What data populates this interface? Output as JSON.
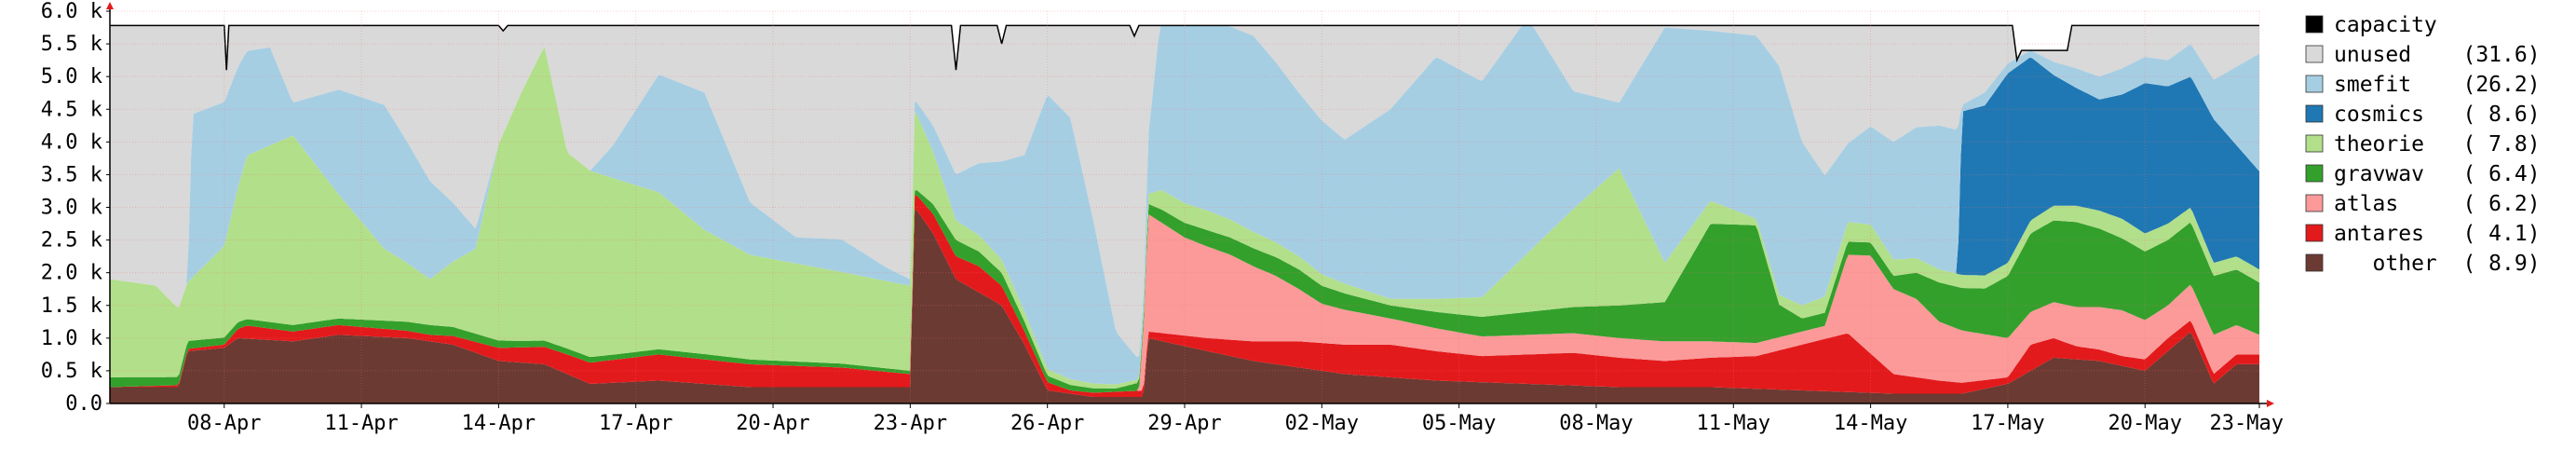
{
  "chart_data": {
    "type": "area",
    "stacked": true,
    "title": "",
    "ylabel": "",
    "ylabel_faint": "",
    "ylim": [
      0,
      6000
    ],
    "y_ticks": [
      {
        "value": 0,
        "label": "0.0"
      },
      {
        "value": 500,
        "label": "0.5 k"
      },
      {
        "value": 1000,
        "label": "1.0 k"
      },
      {
        "value": 1500,
        "label": "1.5 k"
      },
      {
        "value": 2000,
        "label": "2.0 k"
      },
      {
        "value": 2500,
        "label": "2.5 k"
      },
      {
        "value": 3000,
        "label": "3.0 k"
      },
      {
        "value": 3500,
        "label": "3.5 k"
      },
      {
        "value": 4000,
        "label": "4.0 k"
      },
      {
        "value": 4500,
        "label": "4.5 k"
      },
      {
        "value": 5000,
        "label": "5.0 k"
      },
      {
        "value": 5500,
        "label": "5.5 k"
      },
      {
        "value": 6000,
        "label": "6.0 k"
      }
    ],
    "x_start_day": 0,
    "x_end_day": 47,
    "x_ticks": [
      {
        "day": 2.5,
        "label": "08-Apr"
      },
      {
        "day": 5.5,
        "label": "11-Apr"
      },
      {
        "day": 8.5,
        "label": "14-Apr"
      },
      {
        "day": 11.5,
        "label": "17-Apr"
      },
      {
        "day": 14.5,
        "label": "20-Apr"
      },
      {
        "day": 17.5,
        "label": "23-Apr"
      },
      {
        "day": 20.5,
        "label": "26-Apr"
      },
      {
        "day": 23.5,
        "label": "29-Apr"
      },
      {
        "day": 26.5,
        "label": "02-May"
      },
      {
        "day": 29.5,
        "label": "05-May"
      },
      {
        "day": 32.5,
        "label": "08-May"
      },
      {
        "day": 35.5,
        "label": "11-May"
      },
      {
        "day": 38.5,
        "label": "14-May"
      },
      {
        "day": 41.5,
        "label": "17-May"
      },
      {
        "day": 44.5,
        "label": "20-May"
      },
      {
        "day": 47,
        "label": "23-May"
      }
    ],
    "legend": [
      {
        "key": "capacity",
        "label": "capacity",
        "value": "",
        "color": "#000000"
      },
      {
        "key": "unused",
        "label": "unused",
        "value": "(31.6)",
        "color": "#d9d9d9"
      },
      {
        "key": "smefit",
        "label": "smefit",
        "value": "(26.2)",
        "color": "#a6cee3"
      },
      {
        "key": "cosmics",
        "label": "cosmics",
        "value": "( 8.6)",
        "color": "#1f78b4"
      },
      {
        "key": "theorie",
        "label": "theorie",
        "value": "( 7.8)",
        "color": "#b2df8a"
      },
      {
        "key": "gravwav",
        "label": "gravwav",
        "value": "( 6.4)",
        "color": "#33a02c"
      },
      {
        "key": "atlas",
        "label": "atlas",
        "value": "( 6.2)",
        "color": "#fb9a99"
      },
      {
        "key": "antares",
        "label": "antares",
        "value": "( 4.1)",
        "color": "#e31a1c"
      },
      {
        "key": "other",
        "label": "other",
        "value": "( 8.9)",
        "color": "#6b3a32"
      }
    ],
    "capacity": {
      "color": "#000000",
      "points": [
        [
          0,
          5780
        ],
        [
          2.5,
          5780
        ],
        [
          2.55,
          5100
        ],
        [
          2.6,
          5780
        ],
        [
          8.5,
          5780
        ],
        [
          8.6,
          5700
        ],
        [
          8.7,
          5780
        ],
        [
          18.4,
          5780
        ],
        [
          18.5,
          5100
        ],
        [
          18.6,
          5780
        ],
        [
          19.4,
          5780
        ],
        [
          19.5,
          5500
        ],
        [
          19.6,
          5780
        ],
        [
          22.3,
          5780
        ],
        [
          22.4,
          5620
        ],
        [
          22.5,
          5780
        ],
        [
          41.6,
          5780
        ],
        [
          41.7,
          5250
        ],
        [
          41.8,
          5400
        ],
        [
          42.8,
          5400
        ],
        [
          42.9,
          5780
        ],
        [
          47,
          5780
        ]
      ]
    },
    "series": [
      {
        "key": "other",
        "name": "other",
        "color": "#6b3a32",
        "points": [
          [
            0,
            250
          ],
          [
            1.5,
            250
          ],
          [
            1.7,
            800
          ],
          [
            2.5,
            850
          ],
          [
            2.8,
            1000
          ],
          [
            4,
            950
          ],
          [
            5,
            1050
          ],
          [
            6.5,
            1000
          ],
          [
            7.5,
            900
          ],
          [
            8.5,
            650
          ],
          [
            9.5,
            600
          ],
          [
            10.5,
            300
          ],
          [
            12,
            350
          ],
          [
            14,
            250
          ],
          [
            16,
            250
          ],
          [
            17.5,
            250
          ],
          [
            17.6,
            3000
          ],
          [
            18,
            2600
          ],
          [
            18.5,
            1900
          ],
          [
            19.5,
            1500
          ],
          [
            20,
            900
          ],
          [
            20.5,
            200
          ],
          [
            21.5,
            100
          ],
          [
            22.6,
            100
          ],
          [
            22.7,
            1000
          ],
          [
            24,
            800
          ],
          [
            25,
            650
          ],
          [
            27,
            450
          ],
          [
            29,
            350
          ],
          [
            31,
            300
          ],
          [
            33,
            250
          ],
          [
            35,
            250
          ],
          [
            37,
            200
          ],
          [
            39,
            150
          ],
          [
            40.5,
            150
          ],
          [
            41.5,
            300
          ],
          [
            42.5,
            700
          ],
          [
            43.5,
            650
          ],
          [
            44.5,
            500
          ],
          [
            45,
            800
          ],
          [
            45.5,
            1100
          ],
          [
            46,
            300
          ],
          [
            46.5,
            600
          ],
          [
            47,
            600
          ]
        ]
      },
      {
        "key": "antares",
        "name": "antares",
        "color": "#e31a1c",
        "points": [
          [
            0,
            0
          ],
          [
            2.5,
            50
          ],
          [
            3,
            200
          ],
          [
            4,
            150
          ],
          [
            5,
            150
          ],
          [
            7,
            100
          ],
          [
            8.5,
            200
          ],
          [
            10,
            300
          ],
          [
            12,
            400
          ],
          [
            14,
            350
          ],
          [
            16,
            300
          ],
          [
            17.5,
            200
          ],
          [
            18,
            300
          ],
          [
            19,
            400
          ],
          [
            20,
            200
          ],
          [
            21,
            50
          ],
          [
            22.7,
            100
          ],
          [
            24,
            200
          ],
          [
            26,
            400
          ],
          [
            28,
            500
          ],
          [
            30,
            400
          ],
          [
            32,
            500
          ],
          [
            34,
            400
          ],
          [
            36,
            500
          ],
          [
            38,
            900
          ],
          [
            39,
            300
          ],
          [
            40,
            200
          ],
          [
            41.5,
            100
          ],
          [
            42,
            400
          ],
          [
            43,
            200
          ],
          [
            44,
            150
          ],
          [
            45,
            200
          ],
          [
            46,
            150
          ],
          [
            47,
            150
          ]
        ]
      },
      {
        "key": "atlas",
        "name": "atlas",
        "color": "#fb9a99",
        "points": [
          [
            0,
            0
          ],
          [
            17.5,
            0
          ],
          [
            22.5,
            0
          ],
          [
            22.7,
            1800
          ],
          [
            23.5,
            1500
          ],
          [
            24.5,
            1300
          ],
          [
            25.5,
            1000
          ],
          [
            26.5,
            600
          ],
          [
            28,
            400
          ],
          [
            30,
            300
          ],
          [
            32,
            300
          ],
          [
            34,
            300
          ],
          [
            36,
            200
          ],
          [
            37.5,
            200
          ],
          [
            38,
            1200
          ],
          [
            38.5,
            1500
          ],
          [
            39,
            1300
          ],
          [
            39.5,
            1200
          ],
          [
            40,
            900
          ],
          [
            41,
            700
          ],
          [
            42,
            500
          ],
          [
            43,
            600
          ],
          [
            44,
            700
          ],
          [
            45,
            500
          ],
          [
            46,
            600
          ],
          [
            47,
            300
          ]
        ]
      },
      {
        "key": "gravwav",
        "name": "gravwav",
        "color": "#33a02c",
        "points": [
          [
            0,
            150
          ],
          [
            3,
            100
          ],
          [
            5,
            100
          ],
          [
            7,
            150
          ],
          [
            9,
            100
          ],
          [
            11,
            80
          ],
          [
            13,
            80
          ],
          [
            17.5,
            50
          ],
          [
            18.5,
            250
          ],
          [
            19.5,
            200
          ],
          [
            20.5,
            100
          ],
          [
            22,
            50
          ],
          [
            23,
            200
          ],
          [
            24,
            250
          ],
          [
            26,
            300
          ],
          [
            28,
            200
          ],
          [
            30,
            300
          ],
          [
            32,
            400
          ],
          [
            34,
            600
          ],
          [
            35,
            1800
          ],
          [
            36,
            1800
          ],
          [
            36.5,
            500
          ],
          [
            37,
            200
          ],
          [
            39,
            200
          ],
          [
            40,
            600
          ],
          [
            41,
            700
          ],
          [
            42,
            1200
          ],
          [
            43,
            1300
          ],
          [
            44,
            1100
          ],
          [
            45,
            1000
          ],
          [
            46,
            900
          ],
          [
            47,
            800
          ]
        ]
      },
      {
        "key": "theorie",
        "name": "theorie",
        "color": "#b2df8a",
        "points": [
          [
            0,
            1500
          ],
          [
            1,
            1400
          ],
          [
            1.7,
            900
          ],
          [
            2.5,
            1400
          ],
          [
            3,
            2500
          ],
          [
            4,
            2900
          ],
          [
            5,
            1900
          ],
          [
            6,
            1100
          ],
          [
            7,
            700
          ],
          [
            8,
            1300
          ],
          [
            8.5,
            3000
          ],
          [
            9,
            3800
          ],
          [
            9.5,
            4500
          ],
          [
            10,
            3000
          ],
          [
            11,
            2700
          ],
          [
            12,
            2400
          ],
          [
            13,
            1900
          ],
          [
            14,
            1600
          ],
          [
            16,
            1400
          ],
          [
            17.5,
            1300
          ],
          [
            18,
            800
          ],
          [
            18.5,
            300
          ],
          [
            19.5,
            200
          ],
          [
            20.5,
            100
          ],
          [
            22.5,
            50
          ],
          [
            23,
            300
          ],
          [
            24,
            300
          ],
          [
            26,
            200
          ],
          [
            28,
            100
          ],
          [
            30,
            300
          ],
          [
            32,
            1500
          ],
          [
            33,
            2100
          ],
          [
            34,
            600
          ],
          [
            36,
            100
          ],
          [
            38,
            300
          ],
          [
            40,
            200
          ],
          [
            42,
            200
          ],
          [
            44,
            300
          ],
          [
            46,
            200
          ],
          [
            47,
            200
          ]
        ]
      },
      {
        "key": "cosmics",
        "name": "cosmics",
        "color": "#1f78b4",
        "points": [
          [
            0,
            0
          ],
          [
            40.4,
            0
          ],
          [
            40.5,
            2500
          ],
          [
            41,
            2600
          ],
          [
            41.5,
            2900
          ],
          [
            42,
            2500
          ],
          [
            42.5,
            2000
          ],
          [
            43,
            1800
          ],
          [
            43.5,
            1700
          ],
          [
            44,
            1900
          ],
          [
            44.5,
            2300
          ],
          [
            45,
            2100
          ],
          [
            45.5,
            2000
          ],
          [
            46,
            2200
          ],
          [
            46.5,
            1700
          ],
          [
            47,
            1500
          ]
        ]
      },
      {
        "key": "smefit",
        "name": "smefit",
        "color": "#a6cee3",
        "points": [
          [
            0,
            0
          ],
          [
            1.7,
            0
          ],
          [
            1.8,
            2500
          ],
          [
            2.5,
            2200
          ],
          [
            3,
            1600
          ],
          [
            3.5,
            1500
          ],
          [
            4,
            500
          ],
          [
            5,
            1600
          ],
          [
            6,
            2200
          ],
          [
            7,
            1500
          ],
          [
            8,
            300
          ],
          [
            8.5,
            0
          ],
          [
            10.5,
            0
          ],
          [
            11,
            500
          ],
          [
            12,
            1800
          ],
          [
            13,
            2100
          ],
          [
            14,
            800
          ],
          [
            15,
            400
          ],
          [
            16,
            500
          ],
          [
            17,
            200
          ],
          [
            17.5,
            100
          ],
          [
            18.5,
            700
          ],
          [
            19.5,
            1500
          ],
          [
            20,
            2400
          ],
          [
            20.5,
            4200
          ],
          [
            21,
            4000
          ],
          [
            21.5,
            2500
          ],
          [
            22,
            800
          ],
          [
            22.6,
            200
          ],
          [
            23,
            2800
          ],
          [
            24,
            2900
          ],
          [
            25,
            3000
          ],
          [
            26,
            2500
          ],
          [
            27,
            2200
          ],
          [
            28,
            2900
          ],
          [
            29,
            3700
          ],
          [
            30,
            3300
          ],
          [
            31,
            3600
          ],
          [
            32,
            1800
          ],
          [
            33,
            1000
          ],
          [
            34,
            3600
          ],
          [
            35,
            2600
          ],
          [
            36,
            2800
          ],
          [
            36.5,
            3500
          ],
          [
            37,
            2500
          ],
          [
            38,
            1200
          ],
          [
            39,
            1800
          ],
          [
            40,
            2200
          ],
          [
            40.4,
            2200
          ],
          [
            40.5,
            100
          ],
          [
            41,
            200
          ],
          [
            42,
            100
          ],
          [
            43,
            300
          ],
          [
            44,
            400
          ],
          [
            45,
            400
          ],
          [
            46,
            600
          ],
          [
            47,
            1800
          ]
        ]
      }
    ],
    "unused": {
      "key": "unused",
      "name": "unused",
      "color": "#d9d9d9"
    }
  }
}
